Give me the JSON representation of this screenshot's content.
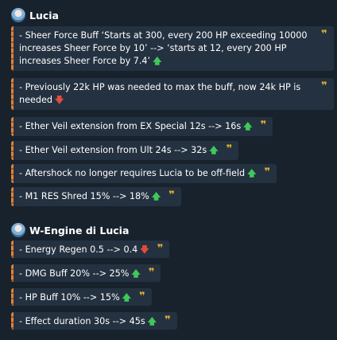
{
  "sections": [
    {
      "title": "Lucia",
      "items": [
        {
          "text": "- Sheer Force Buff ‘Starts at 300, every 200 HP exceeding 10000 increases Sheer Force by 10’ --> ‘starts at 12, every 200 HP increases Sheer Force by 7.4’",
          "arrow": "up"
        },
        {
          "text": "- Previously 22k HP was needed to max the buff, now 24k HP is needed",
          "arrow": "down"
        },
        {
          "text": "- Ether Veil extension from EX Special 12s --> 16s",
          "arrow": "up"
        },
        {
          "text": "- Ether Veil extension from Ult 24s --> 32s",
          "arrow": "up"
        },
        {
          "text": "- Aftershock no longer requires Lucia to be off-field",
          "arrow": "up"
        },
        {
          "text": "- M1 RES Shred 15% --> 18%",
          "arrow": "up"
        }
      ]
    },
    {
      "title": "W-Engine di Lucia",
      "items": [
        {
          "text": "- Energy Regen 0.5 --> 0.4",
          "arrow": "down"
        },
        {
          "text": "- DMG Buff 20% --> 25%",
          "arrow": "up"
        },
        {
          "text": "- HP Buff 10% --> 15%",
          "arrow": "up"
        },
        {
          "text": "- Effect duration 30s --> 45s",
          "arrow": "up"
        }
      ]
    }
  ],
  "icons": {
    "up": "arrow-up-icon",
    "down": "arrow-down-icon",
    "quote": "quote-icon",
    "avatar": "avatar-icon"
  },
  "colors": {
    "background": "#18222d",
    "block": "#243140",
    "accent_bar": "#e0843a",
    "quote": "#e6b32e",
    "arrow_up": "#3fc85a",
    "arrow_down": "#e24c3c"
  },
  "glyphs": {
    "quote": "❞",
    "up": "🡅",
    "down": "🡇"
  }
}
